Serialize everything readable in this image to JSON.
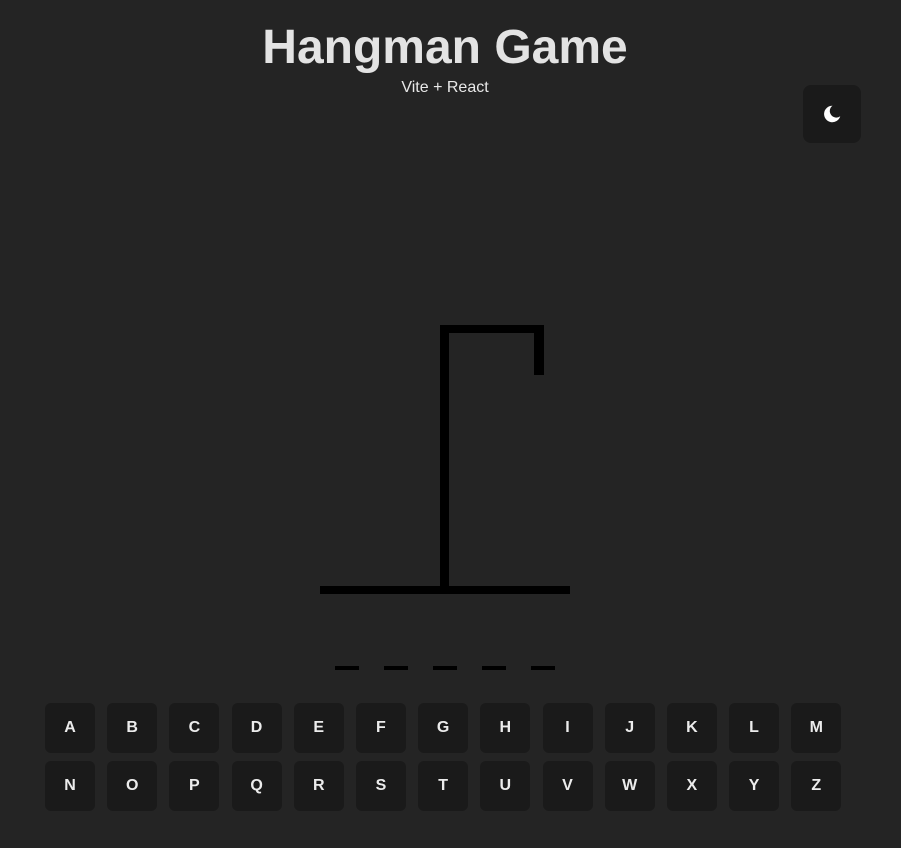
{
  "header": {
    "title": "Hangman Game",
    "subtitle": "Vite + React"
  },
  "theme_toggle": {
    "icon": "moon-icon"
  },
  "game": {
    "word_length": 5
  },
  "keyboard": {
    "letters": [
      "A",
      "B",
      "C",
      "D",
      "E",
      "F",
      "G",
      "H",
      "I",
      "J",
      "K",
      "L",
      "M",
      "N",
      "O",
      "P",
      "Q",
      "R",
      "S",
      "T",
      "U",
      "V",
      "W",
      "X",
      "Y",
      "Z"
    ]
  }
}
